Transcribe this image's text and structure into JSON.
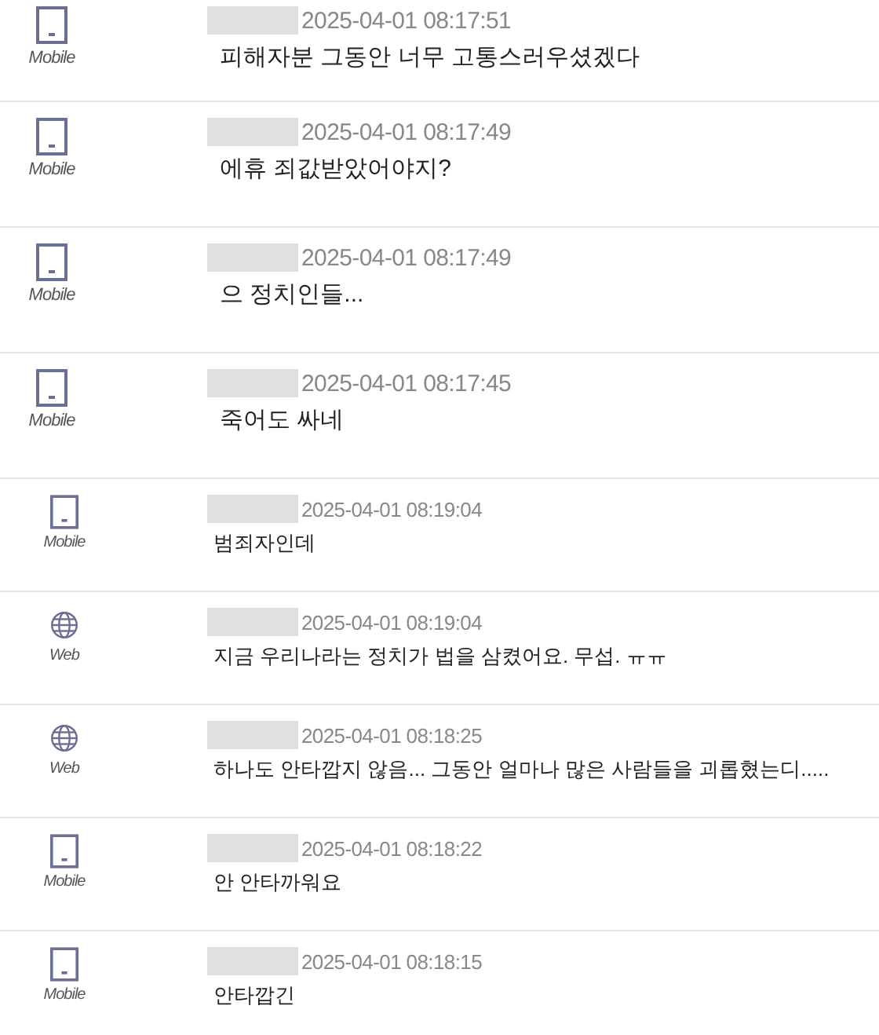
{
  "comments": [
    {
      "kind": "mobile",
      "device": "Mobile",
      "large": true,
      "time": "2025-04-01 08:17:51",
      "text": "피해자분 그동안 너무 고통스러우셨겠다"
    },
    {
      "kind": "mobile",
      "device": "Mobile",
      "large": true,
      "time": "2025-04-01 08:17:49",
      "text": "에휴 죄값받았어야지?"
    },
    {
      "kind": "mobile",
      "device": "Mobile",
      "large": true,
      "time": "2025-04-01 08:17:49",
      "text": "으 정치인들..."
    },
    {
      "kind": "mobile",
      "device": "Mobile",
      "large": true,
      "time": "2025-04-01 08:17:45",
      "text": "죽어도 싸네"
    },
    {
      "kind": "mobile",
      "device": "Mobile",
      "large": false,
      "time": "2025-04-01 08:19:04",
      "text": "범죄자인데"
    },
    {
      "kind": "web",
      "device": "Web",
      "large": false,
      "time": "2025-04-01 08:19:04",
      "text": "지금 우리나라는 정치가 법을 삼켰어요. 무섭. ㅠㅠ"
    },
    {
      "kind": "web",
      "device": "Web",
      "large": false,
      "time": "2025-04-01 08:18:25",
      "text": "하나도 안타깝지 않음... 그동안 얼마나 많은 사람들을 괴롭혔는디....."
    },
    {
      "kind": "mobile",
      "device": "Mobile",
      "large": false,
      "time": "2025-04-01 08:18:22",
      "text": "안 안타까워요"
    },
    {
      "kind": "mobile",
      "device": "Mobile",
      "large": false,
      "time": "2025-04-01 08:18:15",
      "text": "안타깝긴"
    }
  ]
}
